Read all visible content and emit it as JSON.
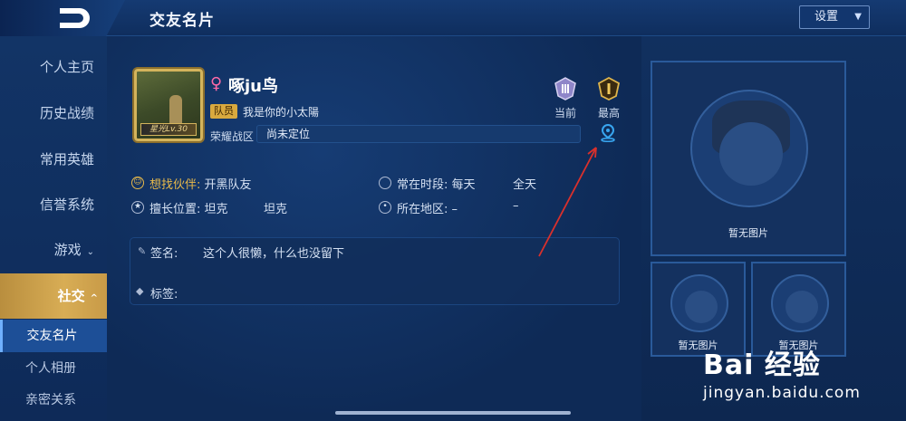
{
  "header": {
    "title": "交友名片",
    "settings_label": "设置"
  },
  "sidebar": {
    "items": [
      {
        "label": "个人主页"
      },
      {
        "label": "历史战绩"
      },
      {
        "label": "常用英雄"
      },
      {
        "label": "信誉系统"
      },
      {
        "label": "游戏"
      },
      {
        "label": "社交"
      }
    ],
    "sub_items": [
      {
        "label": "交友名片"
      },
      {
        "label": "个人相册"
      },
      {
        "label": "亲密关系"
      }
    ]
  },
  "profile": {
    "gender_symbol": "♀",
    "name": "啄ju鸟",
    "role_tag": "队员",
    "signature_line": "我是你的小太陽",
    "avatar_badge": "星光Lv.30",
    "rank_label": "荣耀战区",
    "rank_value": "尚未定位",
    "medals": [
      {
        "label": "当前"
      },
      {
        "label": "最高"
      }
    ]
  },
  "details": {
    "partner_key": "想找伙伴:",
    "partner_val": "开黑队友",
    "time_key": "常在时段:",
    "time_val1": "每天",
    "time_val2": "全天",
    "position_key": "擅长位置:",
    "position_val1": "坦克",
    "position_val2": "坦克",
    "region_key": "所在地区:",
    "region_val1": "–",
    "region_val2": "–"
  },
  "signature": {
    "label": "签名:",
    "value": "这个人很懒，什么也没留下",
    "tags_label": "标签:"
  },
  "gallery": {
    "captions": [
      "暂无图片",
      "暂无图片",
      "暂无图片"
    ]
  },
  "watermark": {
    "brand": "Bai 经验",
    "sub": "jingyan.baidu.com"
  },
  "colors": {
    "accent_gold": "#d8ad55",
    "active_blue": "#1d4f97",
    "annotation_red": "#d9302c"
  }
}
